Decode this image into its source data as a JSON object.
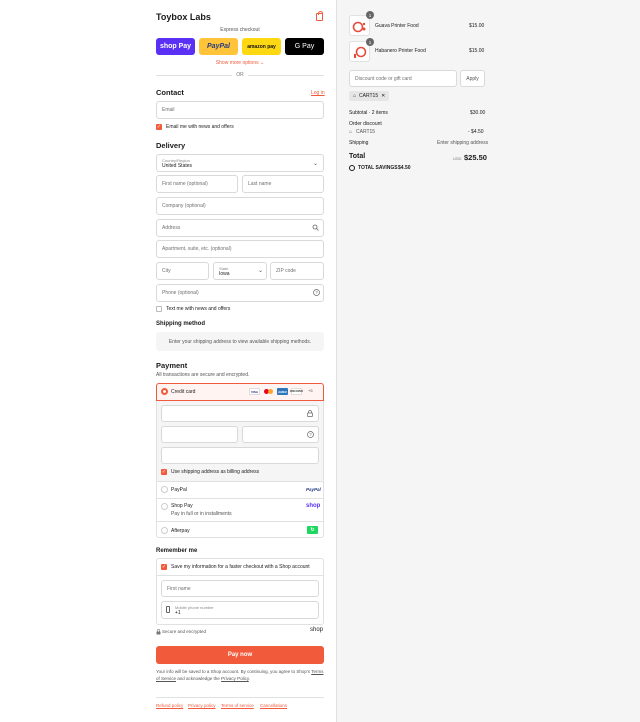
{
  "brand": "Toybox Labs",
  "express": {
    "title": "Express checkout",
    "shop_pay": "shop Pay",
    "paypal": "PayPal",
    "amazon_pay": "amazon pay",
    "gpay": "G Pay",
    "more_options": "Show more options",
    "or": "OR"
  },
  "contact": {
    "heading": "Contact",
    "login": "Log in",
    "email_placeholder": "Email",
    "email_news_label": "Email me with news and offers"
  },
  "delivery": {
    "heading": "Delivery",
    "country_label": "Country/Region",
    "country_value": "United States",
    "first_name_placeholder": "First name (optional)",
    "last_name_placeholder": "Last name",
    "company_placeholder": "Company (optional)",
    "address_placeholder": "Address",
    "apartment_placeholder": "Apartment, suite, etc. (optional)",
    "city_placeholder": "City",
    "state_label": "State",
    "state_value": "Iowa",
    "zip_placeholder": "ZIP code",
    "phone_placeholder": "Phone (optional)",
    "text_news_label": "Text me with news and offers"
  },
  "shipping": {
    "heading": "Shipping method",
    "message": "Enter your shipping address to view available shipping methods."
  },
  "payment": {
    "heading": "Payment",
    "subtitle": "All transactions are secure and encrypted.",
    "credit_card_label": "Credit card",
    "card_brands": [
      "VISA",
      "MC",
      "AMEX",
      "DISCOVER"
    ],
    "more_cards": "+5",
    "billing_label": "Use shipping address as billing address",
    "paypal_label": "PayPal",
    "paypal_logo": "PayPal",
    "shoppay_label": "Shop Pay",
    "shoppay_sub": "Pay in full or in installments",
    "shoppay_logo": "shop",
    "afterpay_label": "Afterpay"
  },
  "remember": {
    "heading": "Remember me",
    "save_label": "Save my information for a faster checkout with a Shop account",
    "first_name_placeholder": "First name",
    "mobile_label": "Mobile phone number",
    "mobile_value": "+1",
    "secure_label": "Secure and encrypted",
    "shop_logo": "shop"
  },
  "pay_button": "Pay now",
  "fine_print": {
    "part1": "Your info will be saved to a Shop account. By continuing, you agree to Shop's",
    "terms": "Terms of Service",
    "part2": "and acknowledge the",
    "privacy": "Privacy Policy",
    "end": "."
  },
  "footer_links": [
    "Refund policy",
    "Privacy policy",
    "Terms of service",
    "Cancellations"
  ],
  "cart": {
    "items": [
      {
        "name": "Guava Printer Food",
        "qty": "1",
        "price": "$15.00"
      },
      {
        "name": "Habanero Printer Food",
        "qty": "1",
        "price": "$15.00"
      }
    ],
    "discount_placeholder": "Discount code or gift card",
    "apply_label": "Apply",
    "applied_code": "CART15",
    "subtotal_label": "Subtotal · 2 items",
    "subtotal_value": "$30.00",
    "order_discount_label": "Order discount",
    "discount_code": "CART15",
    "discount_value": "- $4.50",
    "shipping_label": "Shipping",
    "shipping_value": "Enter shipping address",
    "total_label": "Total",
    "currency": "USD",
    "total_value": "$25.50",
    "savings_label": "TOTAL SAVINGS",
    "savings_value": "$4.50"
  },
  "colors": {
    "accent": "#f15a3b",
    "shop_purple": "#5a31f4",
    "paypal_yellow": "#ffc439",
    "afterpay_green": "#1ed760"
  }
}
